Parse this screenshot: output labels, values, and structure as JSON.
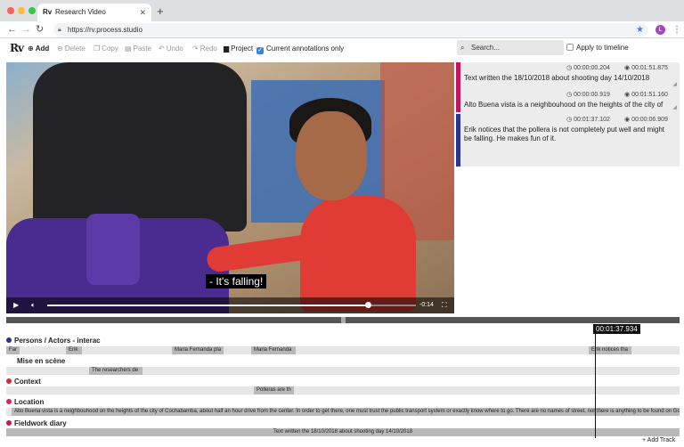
{
  "browser": {
    "tab_title": "Research Video",
    "tab_favicon": "Rv",
    "url": "https://rv.process.studio",
    "avatar_letter": "L"
  },
  "toolbar": {
    "logo": "Rv",
    "add": "Add",
    "delete": "Delete",
    "copy": "Copy",
    "paste": "Paste",
    "undo": "Undo",
    "redo": "Redo",
    "project": "Project",
    "current_only": "Current annotations only",
    "current_only_checked": true
  },
  "search": {
    "placeholder": "Search...",
    "apply_label": "Apply to timeline",
    "apply_checked": false
  },
  "video": {
    "subtitle": "- It's falling!",
    "remaining": "-0:14",
    "progress": 0.87
  },
  "annotations": [
    {
      "start": "00:00:00.204",
      "end": "00:01:51.875",
      "color": "#c2185b",
      "text": "Text written the 18/10/2018 about shooting day 14/10/2018"
    },
    {
      "start": "00:00:00.919",
      "end": "00:01:51.160",
      "color": "#c2185b",
      "text": "Alto Buena vista is a neighbouhood on the heights of the city of"
    },
    {
      "start": "00:01:37.102",
      "end": "00:00:06.909",
      "color": "#283593",
      "text": "Erik notices that the pollera is not completely put well and might be falling. He makes fun of it."
    }
  ],
  "timeline": {
    "current_time": "00:01:37.934",
    "add_track": "+ Add Track",
    "tracks": [
      {
        "name": "Persons / Actors - interac",
        "color": "#283593",
        "segments": [
          "Far",
          "Erik",
          "Maria Fernanda pla",
          "Maria Fernanda",
          "Erik notices tha"
        ]
      },
      {
        "name": "Mise en scène",
        "color": "",
        "segments": [
          "The researchers de"
        ]
      },
      {
        "name": "Context",
        "color": "#d32f2f",
        "segments": [
          "Polleras are th"
        ]
      },
      {
        "name": "Location",
        "color": "#e91e63",
        "segments": [
          "Alto Buena vista is a neighbouhood on the heights of the city of Cochabamba, about half an hour drive from the center. In order to get there, one must trust the public transport system or exactly know where to go. There are no names of street, nor there is anything to be found on Goo"
        ]
      },
      {
        "name": "Fieldwork diary",
        "color": "#c2185b",
        "segments": [
          "Text written the 18/10/2018 about shooting day 14/10/2018"
        ]
      }
    ]
  }
}
